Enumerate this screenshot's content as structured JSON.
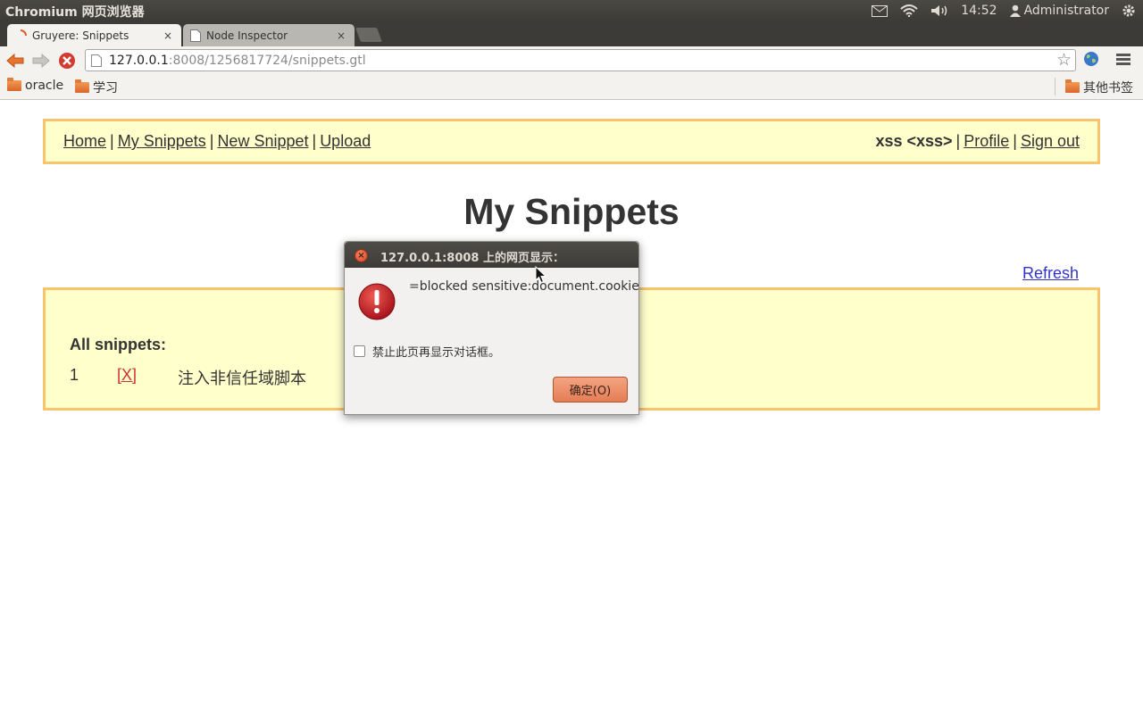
{
  "system_panel": {
    "app_title": "Chromium 网页浏览器",
    "time": "14:52",
    "user": "Administrator",
    "icons": [
      "mail-icon",
      "wifi-icon",
      "volume-icon",
      "user-icon",
      "gear-icon"
    ]
  },
  "tabs": [
    {
      "label": "Gruyere: Snippets",
      "close": "×",
      "active": true,
      "icon": "loading-spinner-icon"
    },
    {
      "label": "Node Inspector",
      "close": "×",
      "active": false,
      "icon": "page-icon"
    }
  ],
  "toolbar": {
    "url_host": "127.0.0.1",
    "url_rest": ":8008/1256817724/snippets.gtl",
    "star_glyph": "☆"
  },
  "bookmarks": {
    "items": [
      {
        "label": "oracle"
      },
      {
        "label": "学习"
      }
    ],
    "other_label": "其他书签"
  },
  "menubar": {
    "home": "Home",
    "my_snippets": "My Snippets",
    "new_snippet": "New Snippet",
    "upload": "Upload",
    "user": "xss <xss>",
    "profile": "Profile",
    "sign_out": "Sign out",
    "sep": "|"
  },
  "page": {
    "title": "My Snippets",
    "refresh": "Refresh",
    "all_snippets_label": "All snippets:",
    "snippets": [
      {
        "number": "1",
        "delete": "[X]",
        "text": "注入非信任域脚本"
      }
    ]
  },
  "dialog": {
    "title": "127.0.0.1:8008 上的网页显示：",
    "close": "×",
    "message": "=blocked sensitive:document.cookie",
    "checkbox_label": "禁止此页再显示对话框。",
    "ok_label": "确定(O)"
  },
  "colors": {
    "panel_bg": "#3c3b37",
    "menubar_bg": "#ffffcc",
    "menubar_border": "#f9c46e",
    "link_blue": "#3333cc",
    "delete_red": "#cc3333",
    "ok_button": "#e57c55"
  }
}
